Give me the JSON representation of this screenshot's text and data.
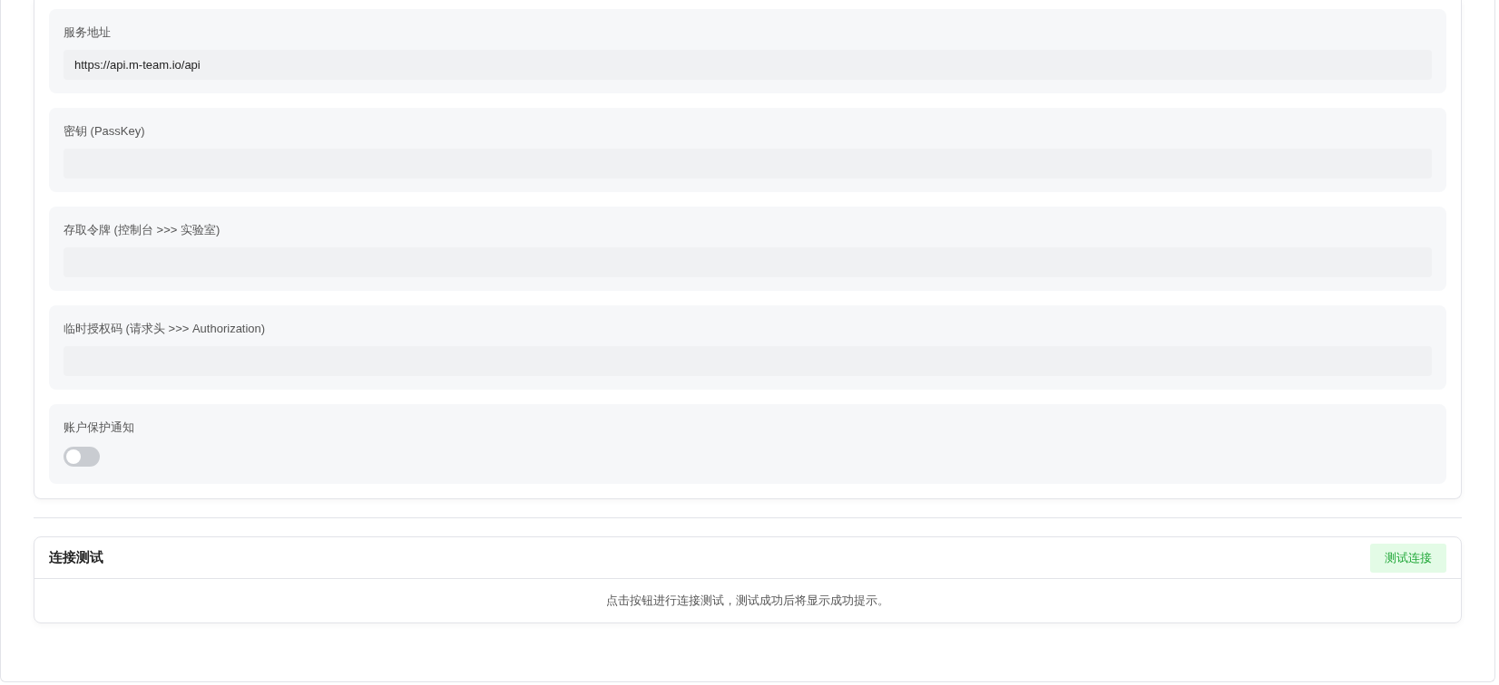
{
  "settings": {
    "fields": [
      {
        "kind": "text",
        "label": "服务地址",
        "value": "https://api.m-team.io/api"
      },
      {
        "kind": "text",
        "label": "密钥 (PassKey)"
      },
      {
        "kind": "text",
        "label": "存取令牌 (控制台 >>> 实验室)"
      },
      {
        "kind": "text",
        "label": "临时授权码 (请求头 >>> Authorization)"
      },
      {
        "kind": "switch",
        "label": "账户保护通知",
        "on": false
      }
    ]
  },
  "connection_test": {
    "title": "连接测试",
    "button": "测试连接",
    "message": "点击按钮进行连接测试，测试成功后将显示成功提示。"
  }
}
